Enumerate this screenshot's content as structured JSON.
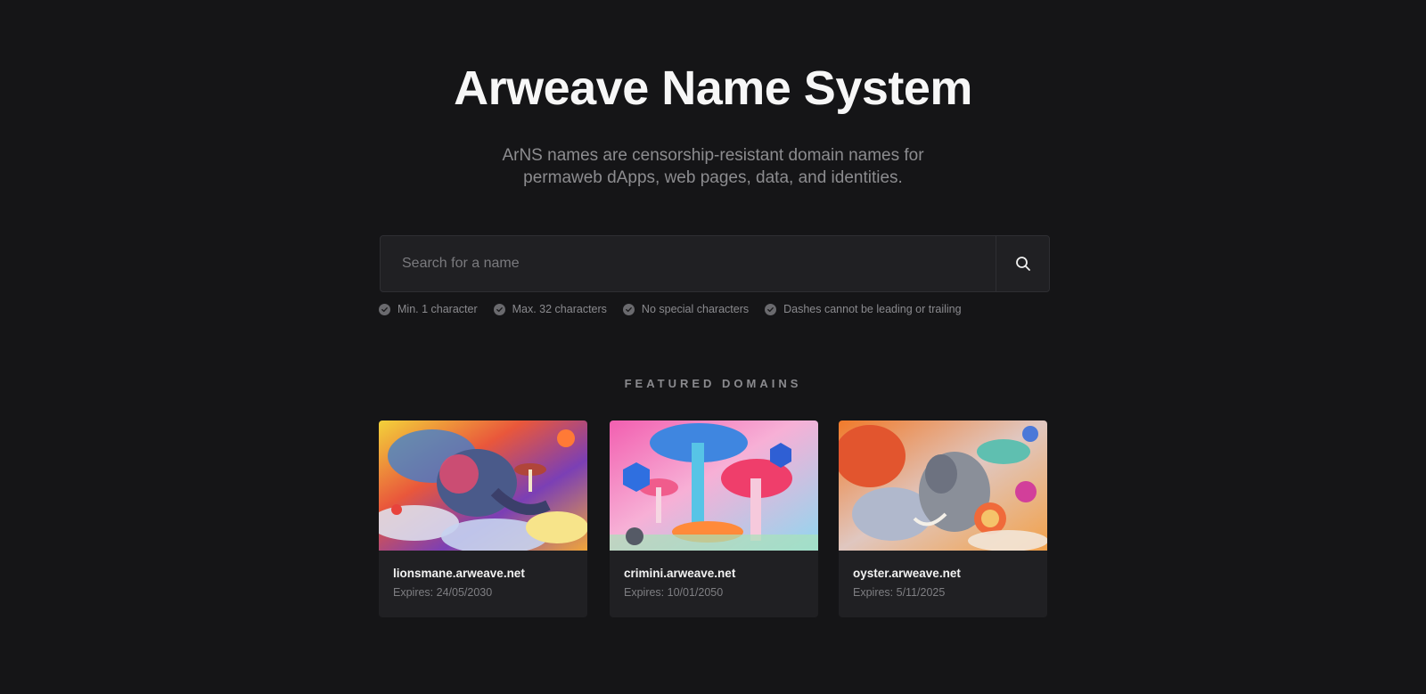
{
  "hero": {
    "title": "Arweave Name System",
    "subtitle_line1": "ArNS names are censorship-resistant domain names for",
    "subtitle_line2": "permaweb dApps, web pages, data, and identities."
  },
  "search": {
    "placeholder": "Search for a name",
    "icon": "search-icon"
  },
  "rules": [
    "Min. 1 character",
    "Max. 32 characters",
    "No special characters",
    "Dashes cannot be leading or trailing"
  ],
  "featured": {
    "title": "FEATURED DOMAINS",
    "cards": [
      {
        "name": "lionsmane.arweave.net",
        "expiry": "Expires: 24/05/2030"
      },
      {
        "name": "crimini.arweave.net",
        "expiry": "Expires: 10/01/2050"
      },
      {
        "name": "oyster.arweave.net",
        "expiry": "Expires: 5/11/2025"
      }
    ]
  },
  "colors": {
    "background": "#151517",
    "surface": "#202023",
    "muted_text": "#8a8a8e"
  }
}
